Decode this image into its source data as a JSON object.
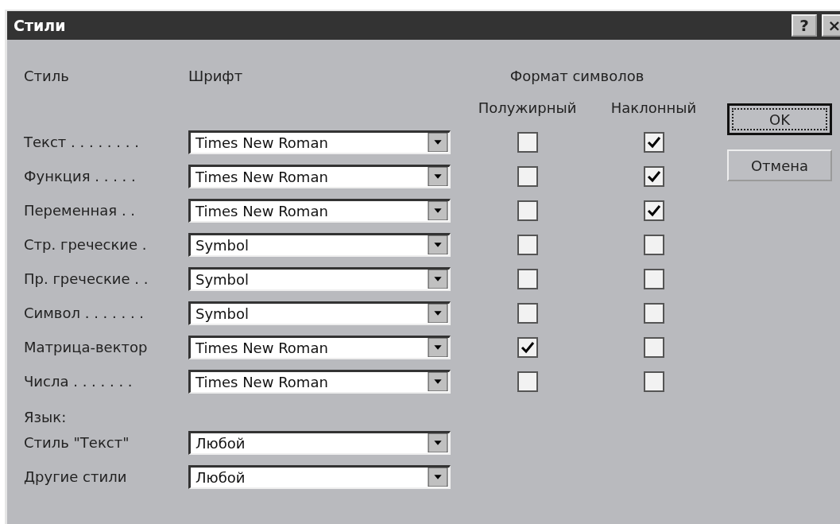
{
  "window": {
    "title": "Стили",
    "help_button": "?",
    "close_button": "×"
  },
  "headers": {
    "style": "Стиль",
    "font": "Шрифт",
    "format": "Формат символов",
    "bold": "Полужирный",
    "italic": "Наклонный"
  },
  "styles": [
    {
      "name": "Текст . . . . . . . .",
      "font": "Times New Roman",
      "bold": false,
      "italic": true
    },
    {
      "name": "Функция . . . . .",
      "font": "Times New Roman",
      "bold": false,
      "italic": true
    },
    {
      "name": "Переменная . .",
      "font": "Times New Roman",
      "bold": false,
      "italic": true
    },
    {
      "name": "Стр. греческие .",
      "font": "Symbol",
      "bold": false,
      "italic": false
    },
    {
      "name": "Пр. греческие . .",
      "font": "Symbol",
      "bold": false,
      "italic": false
    },
    {
      "name": "Символ . . . . . . .",
      "font": "Symbol",
      "bold": false,
      "italic": false
    },
    {
      "name": "Матрица-вектор",
      "font": "Times New Roman",
      "bold": true,
      "italic": false
    },
    {
      "name": "Числа . . . . . . .",
      "font": "Times New Roman",
      "bold": false,
      "italic": false
    }
  ],
  "language": {
    "label": "Язык:",
    "rows": [
      {
        "name": "Стиль \"Текст\"",
        "value": "Любой"
      },
      {
        "name": "Другие стили",
        "value": "Любой"
      }
    ]
  },
  "buttons": [
    {
      "label": "OK",
      "focused": true
    },
    {
      "label": "Отмена",
      "focused": false
    }
  ]
}
